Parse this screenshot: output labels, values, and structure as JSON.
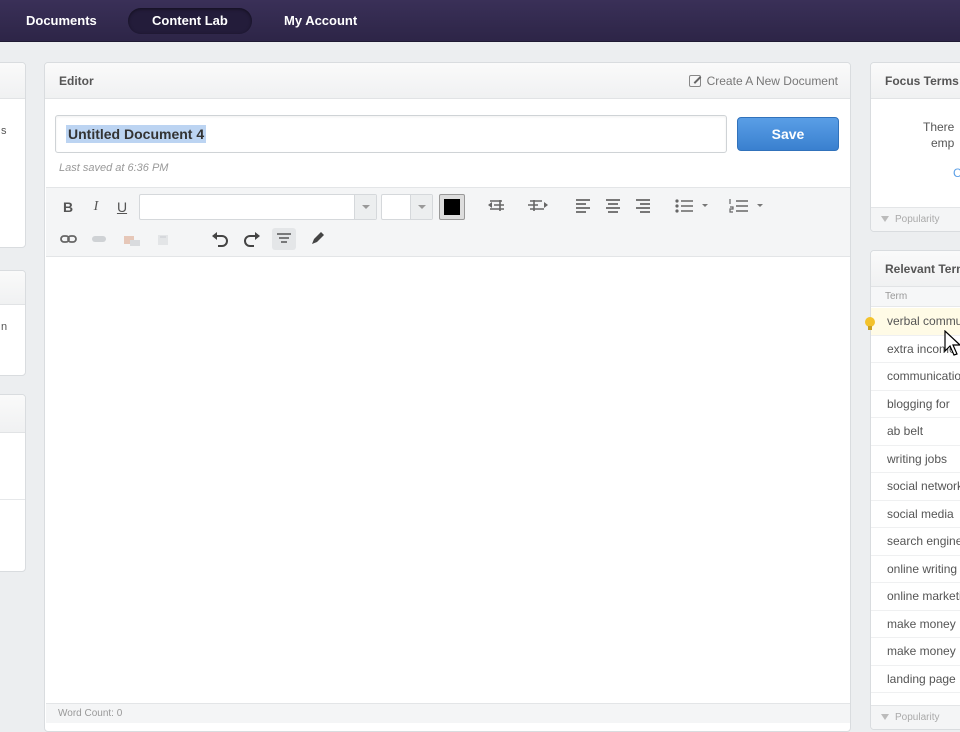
{
  "nav": {
    "items": [
      {
        "label": "Documents"
      },
      {
        "label": "Content Lab"
      },
      {
        "label": "My Account"
      }
    ]
  },
  "left": {
    "stub1_text": "s",
    "stub2_text": "n"
  },
  "editor": {
    "header": "Editor",
    "create_link": "Create A New Document",
    "title_value": "Untitled Document 4",
    "save_label": "Save",
    "saved_note": "Last saved at 6:36 PM",
    "bold": "B",
    "italic": "I",
    "underline": "U",
    "word_count": "Word Count: 0"
  },
  "focus": {
    "header": "Focus Terms",
    "line1": "There",
    "line2": "emp",
    "line3": "C",
    "footer": "Popularity"
  },
  "relevant": {
    "header": "Relevant Terms",
    "column": "Term",
    "terms": [
      "verbal communication",
      "extra income",
      "communication",
      "blogging for",
      "ab belt",
      "writing jobs",
      "social networking",
      "social media",
      "search engine",
      "online writing",
      "online marketing",
      "make money",
      "make money",
      "landing page"
    ],
    "footer": "Popularity"
  },
  "colors": {
    "nav_bg": "#2d2547",
    "save_btn": "#3a80cf"
  }
}
